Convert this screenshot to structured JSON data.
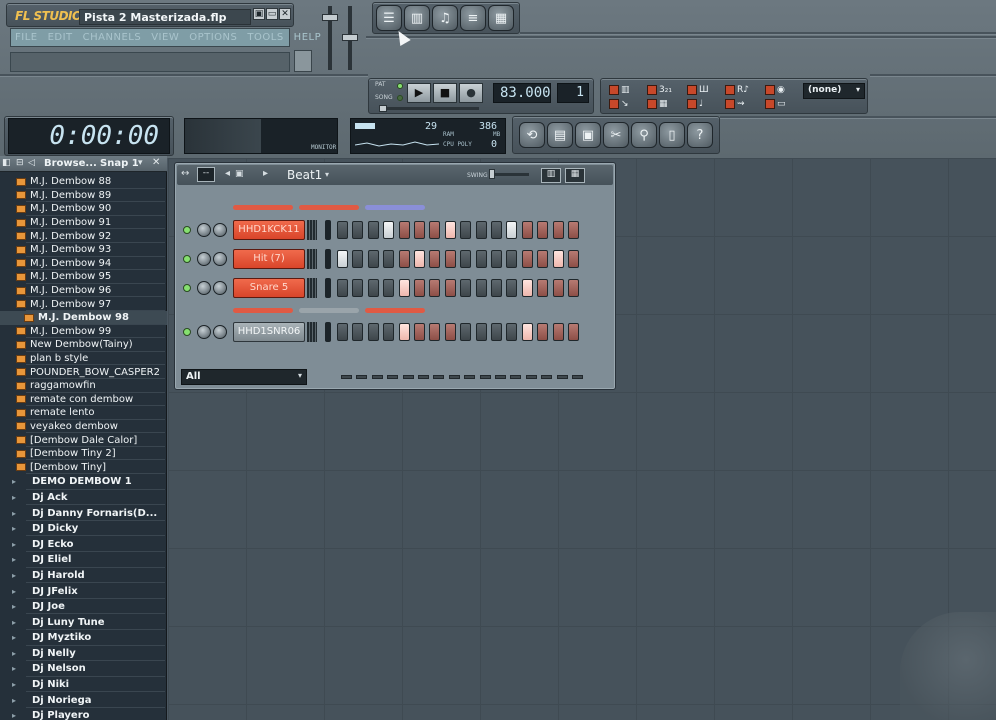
{
  "app": {
    "logo": "FL STUDIO",
    "song_title": "Pista 2 Masterizada.flp",
    "window_buttons": [
      "▣",
      "▭",
      "✕"
    ]
  },
  "menu": [
    "FILE",
    "EDIT",
    "CHANNELS",
    "VIEW",
    "OPTIONS",
    "TOOLS",
    "HELP"
  ],
  "view_buttons": [
    "playlist-icon",
    "mixer-icon",
    "piano-roll-icon",
    "browser-icon",
    "step-sequencer-icon"
  ],
  "transport": {
    "pat_label": "PAT",
    "song_label": "SONG",
    "play": "▶",
    "stop": "■",
    "record": "●",
    "tempo": "83.000",
    "pattern": "1"
  },
  "record_select": "(none)",
  "time": "0:00:00",
  "monitor_label": "MONITOR",
  "cpu": {
    "value": "29",
    "ram_label": "RAM",
    "mem": "386",
    "mb_label": "MB",
    "cpu_label": "CPU  POLY",
    "poly": "0"
  },
  "tool_buttons": [
    "undo-icon",
    "save-icon",
    "export-icon",
    "cut-icon",
    "search-icon",
    "notes-icon",
    "help-icon"
  ],
  "browser": {
    "title": "Browse...",
    "snap": "Snap 1",
    "items": [
      {
        "label": "M.J. Dembow 88",
        "type": "folder"
      },
      {
        "label": "M.J. Dembow 89",
        "type": "folder"
      },
      {
        "label": "M.J. Dembow 90",
        "type": "folder"
      },
      {
        "label": "M.J. Dembow 91",
        "type": "folder"
      },
      {
        "label": "M.J. Dembow 92",
        "type": "folder"
      },
      {
        "label": "M.J. Dembow 93",
        "type": "folder"
      },
      {
        "label": "M.J. Dembow 94",
        "type": "folder"
      },
      {
        "label": "M.J. Dembow 95",
        "type": "folder"
      },
      {
        "label": "M.J. Dembow 96",
        "type": "folder"
      },
      {
        "label": "M.J. Dembow 97",
        "type": "folder"
      },
      {
        "label": "M.J. Dembow 98",
        "type": "folder",
        "selected": true
      },
      {
        "label": "M.J. Dembow 99",
        "type": "folder"
      },
      {
        "label": "New Dembow(Tainy)",
        "type": "folder"
      },
      {
        "label": "plan b style",
        "type": "folder"
      },
      {
        "label": "POUNDER_BOW_CASPER2",
        "type": "folder"
      },
      {
        "label": "raggamowfin",
        "type": "folder"
      },
      {
        "label": "remate con  dembow",
        "type": "folder"
      },
      {
        "label": "remate lento",
        "type": "folder"
      },
      {
        "label": "veyakeo dembow",
        "type": "folder"
      },
      {
        "label": "[Dembow Dale Calor]",
        "type": "folder"
      },
      {
        "label": "[Dembow Tiny 2]",
        "type": "folder"
      },
      {
        "label": "[Dembow Tiny]",
        "type": "folder"
      },
      {
        "label": "DEMO DEMBOW 1",
        "type": "sub"
      },
      {
        "label": "Dj Ack",
        "type": "sub"
      },
      {
        "label": "Dj Danny Fornaris(D...",
        "type": "sub"
      },
      {
        "label": "DJ Dicky",
        "type": "sub"
      },
      {
        "label": "DJ Ecko",
        "type": "sub"
      },
      {
        "label": "DJ Eliel",
        "type": "sub"
      },
      {
        "label": "Dj Harold",
        "type": "sub"
      },
      {
        "label": "DJ JFelix",
        "type": "sub"
      },
      {
        "label": "DJ Joe",
        "type": "sub"
      },
      {
        "label": "Dj Luny Tune",
        "type": "sub"
      },
      {
        "label": "DJ Myztiko",
        "type": "sub"
      },
      {
        "label": "Dj Nelly",
        "type": "sub"
      },
      {
        "label": "Dj Nelson",
        "type": "sub"
      },
      {
        "label": "Dj Niki",
        "type": "sub"
      },
      {
        "label": "Dj Noriega",
        "type": "sub"
      },
      {
        "label": "Dj Playero",
        "type": "sub"
      }
    ]
  },
  "sequencer": {
    "pattern": "Beat1",
    "swing_label": "SWING",
    "filter": "All",
    "channels": [
      {
        "name": "HHD1KCK11",
        "color": "red",
        "steps": [
          0,
          0,
          0,
          1,
          0,
          0,
          0,
          1,
          0,
          0,
          0,
          1,
          0,
          0,
          0,
          0
        ]
      },
      {
        "name": "Hit (7)",
        "color": "red",
        "steps": [
          1,
          0,
          0,
          0,
          0,
          1,
          0,
          0,
          0,
          0,
          0,
          0,
          0,
          0,
          1,
          0
        ]
      },
      {
        "name": "Snare 5",
        "color": "red",
        "steps": [
          0,
          0,
          0,
          0,
          1,
          0,
          0,
          0,
          0,
          0,
          0,
          0,
          1,
          0,
          0,
          0
        ]
      },
      {
        "name": "HHD1SNR06",
        "color": "grey",
        "steps": [
          0,
          0,
          0,
          0,
          1,
          0,
          0,
          0,
          0,
          0,
          0,
          0,
          1,
          0,
          0,
          0
        ]
      }
    ]
  }
}
